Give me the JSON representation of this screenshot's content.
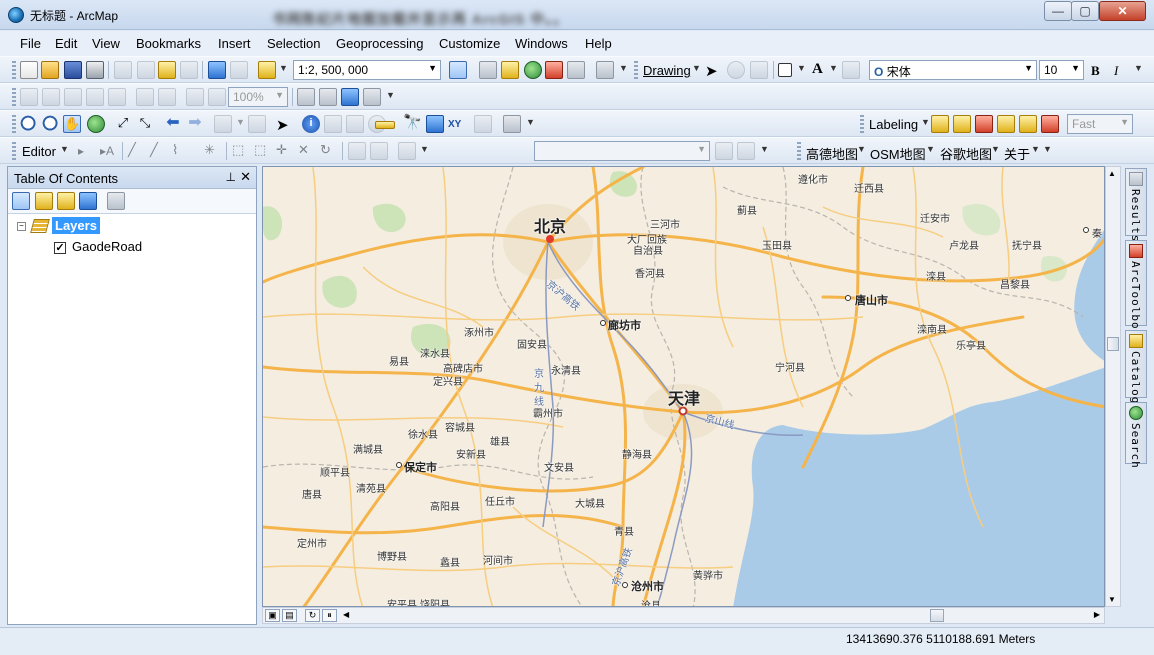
{
  "window": {
    "title": "无标题 - ArcMap",
    "blurred_title": "书网陈纪片地图加载并显示再 ArcGIS 中。。",
    "min": "—",
    "max": "▢",
    "close": "✕"
  },
  "menubar": {
    "items": [
      {
        "label": "File"
      },
      {
        "label": "Edit"
      },
      {
        "label": "View"
      },
      {
        "label": "Bookmarks"
      },
      {
        "label": "Insert"
      },
      {
        "label": "Selection"
      },
      {
        "label": "Geoprocessing"
      },
      {
        "label": "Customize"
      },
      {
        "label": "Windows"
      },
      {
        "label": "Help"
      }
    ]
  },
  "toolbar": {
    "scale": "1:2, 500, 000",
    "drawing_label": "Drawing",
    "font_name": "宋体",
    "font_size": "10",
    "bold": "B",
    "italic": "I",
    "text_tool": "A",
    "zoom_percent": "100%",
    "labeling_label": "Labeling",
    "label_quality": "Fast",
    "editor_label": "Editor",
    "xy": "XY",
    "tile_menus": [
      {
        "label": "高德地图"
      },
      {
        "label": "OSM地图"
      },
      {
        "label": "谷歌地图"
      },
      {
        "label": "关于"
      }
    ]
  },
  "toc": {
    "title": "Table Of Contents",
    "pin": "⊥",
    "close": "✕",
    "group": "Layers",
    "expander": "−",
    "layer": "GaodeRoad",
    "layer_checked": "✓"
  },
  "map": {
    "labels": [
      {
        "text": "北京",
        "kind": "big"
      },
      {
        "text": "天津",
        "kind": "big"
      },
      {
        "text": "廊坊市",
        "kind": "mid"
      },
      {
        "text": "唐山市",
        "kind": "mid"
      },
      {
        "text": "保定市",
        "kind": "mid"
      },
      {
        "text": "沧州市",
        "kind": "mid"
      },
      {
        "text": "遵化市",
        "kind": "small"
      },
      {
        "text": "迁西县",
        "kind": "small"
      },
      {
        "text": "蓟县",
        "kind": "small"
      },
      {
        "text": "三河市",
        "kind": "small"
      },
      {
        "text": "大厂回族",
        "kind": "small"
      },
      {
        "text": "自治县",
        "kind": "small"
      },
      {
        "text": "玉田县",
        "kind": "small"
      },
      {
        "text": "迁安市",
        "kind": "small"
      },
      {
        "text": "卢龙县",
        "kind": "small"
      },
      {
        "text": "抚宁县",
        "kind": "small"
      },
      {
        "text": "秦",
        "kind": "small"
      },
      {
        "text": "香河县",
        "kind": "small"
      },
      {
        "text": "滦县",
        "kind": "small"
      },
      {
        "text": "昌黎县",
        "kind": "small"
      },
      {
        "text": "京沪高铁",
        "kind": "road"
      },
      {
        "text": "涿州市",
        "kind": "small"
      },
      {
        "text": "固安县",
        "kind": "small"
      },
      {
        "text": "滦南县",
        "kind": "small"
      },
      {
        "text": "易县",
        "kind": "small"
      },
      {
        "text": "涞水县",
        "kind": "small"
      },
      {
        "text": "高碑店市",
        "kind": "small"
      },
      {
        "text": "永清县",
        "kind": "small"
      },
      {
        "text": "宁河县",
        "kind": "small"
      },
      {
        "text": "乐亭县",
        "kind": "small"
      },
      {
        "text": "定兴县",
        "kind": "small"
      },
      {
        "text": "霸州市",
        "kind": "small"
      },
      {
        "text": "京",
        "kind": "road"
      },
      {
        "text": "九",
        "kind": "road"
      },
      {
        "text": "线",
        "kind": "road"
      },
      {
        "text": "京山线",
        "kind": "road"
      },
      {
        "text": "容城县",
        "kind": "small"
      },
      {
        "text": "徐水县",
        "kind": "small"
      },
      {
        "text": "雄县",
        "kind": "small"
      },
      {
        "text": "满城县",
        "kind": "small"
      },
      {
        "text": "安新县",
        "kind": "small"
      },
      {
        "text": "静海县",
        "kind": "small"
      },
      {
        "text": "顺平县",
        "kind": "small"
      },
      {
        "text": "文安县",
        "kind": "small"
      },
      {
        "text": "清苑县",
        "kind": "small"
      },
      {
        "text": "唐县",
        "kind": "small"
      },
      {
        "text": "高阳县",
        "kind": "small"
      },
      {
        "text": "任丘市",
        "kind": "small"
      },
      {
        "text": "大城县",
        "kind": "small"
      },
      {
        "text": "青县",
        "kind": "small"
      },
      {
        "text": "定州市",
        "kind": "small"
      },
      {
        "text": "博野县",
        "kind": "small"
      },
      {
        "text": "蠡县",
        "kind": "small"
      },
      {
        "text": "河间市",
        "kind": "small"
      },
      {
        "text": "黄骅市",
        "kind": "small"
      },
      {
        "text": "安平县",
        "kind": "small"
      },
      {
        "text": "饶阳县",
        "kind": "small"
      },
      {
        "text": "沧县",
        "kind": "small"
      },
      {
        "text": "京沪高铁",
        "kind": "road"
      }
    ]
  },
  "sidetabs": [
    {
      "label": "Results"
    },
    {
      "label": "ArcToolbox"
    },
    {
      "label": "Catalog"
    },
    {
      "label": "Search"
    }
  ],
  "status": {
    "coordinates": "13413690.376  5110188.691 Meters"
  }
}
